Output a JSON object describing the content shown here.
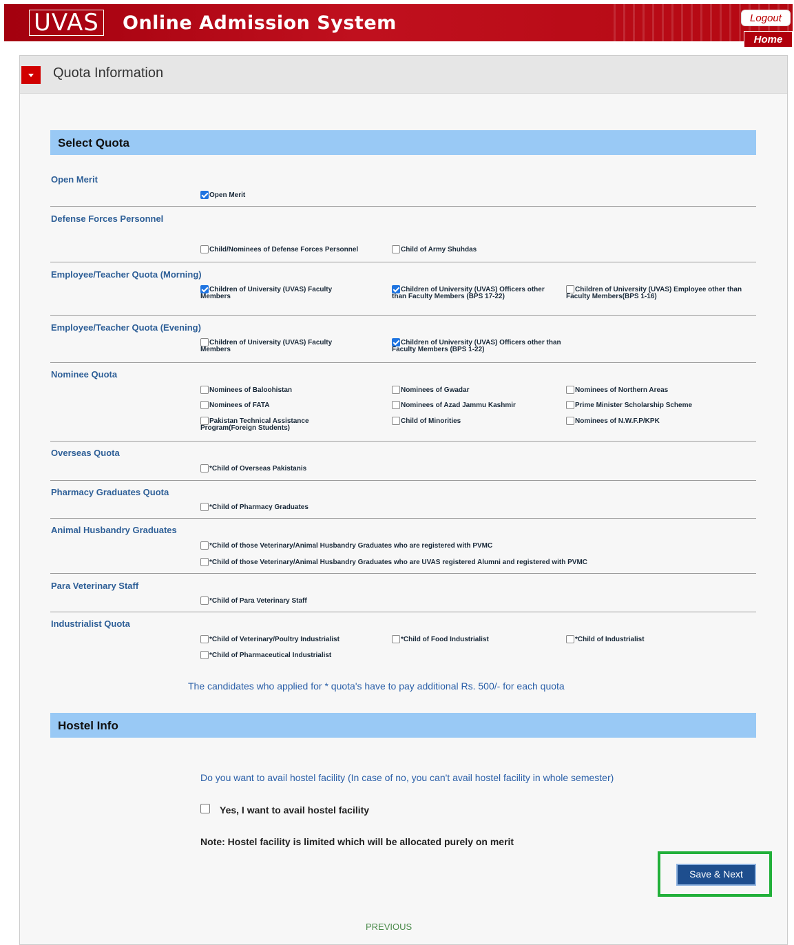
{
  "header": {
    "logo_text": "UVAS",
    "title": "Online Admission System",
    "logout_label": "Logout",
    "home_label": "Home",
    "brand_color": "#b0000c"
  },
  "panel": {
    "title": "Quota Information"
  },
  "select_quota": {
    "heading": "Select Quota",
    "groups": {
      "open_merit": {
        "label": "Open Merit",
        "options": [
          {
            "text": "Open Merit",
            "checked": true
          }
        ]
      },
      "defense": {
        "label": "Defense Forces Personnel",
        "options": [
          {
            "text": "Child/Nominees  of Defense Forces Personnel",
            "checked": false
          },
          {
            "text": "Child of Army Shuhdas",
            "checked": false
          }
        ]
      },
      "emp_morning": {
        "label": "Employee/Teacher Quota (Morning)",
        "options": [
          {
            "text": "Children of University (UVAS) Faculty Members",
            "checked": true
          },
          {
            "text": "Children of University (UVAS) Officers other than Faculty Members (BPS 17-22)",
            "checked": true
          },
          {
            "text": "Children of University (UVAS) Employee other than Faculty Members(BPS 1-16)",
            "checked": false
          }
        ]
      },
      "emp_evening": {
        "label": "Employee/Teacher Quota (Evening)",
        "options": [
          {
            "text": "Children of University (UVAS) Faculty Members",
            "checked": false
          },
          {
            "text": "Children of University (UVAS) Officers other than Faculty Members (BPS 1-22)",
            "checked": true
          }
        ]
      },
      "nominee": {
        "label": "Nominee Quota",
        "options": [
          {
            "text": "Nominees of Baloohistan",
            "checked": false
          },
          {
            "text": "Nominees of Gwadar",
            "checked": false
          },
          {
            "text": "Nominees of Northern Areas",
            "checked": false
          },
          {
            "text": "Nominees of FATA",
            "checked": false
          },
          {
            "text": "Nominees of Azad Jammu Kashmir",
            "checked": false
          },
          {
            "text": "Prime Minister Scholarship Scheme",
            "checked": false
          },
          {
            "text": "Pakistan Technical Assistance Program(Foreign Students)",
            "checked": false
          },
          {
            "text": "Child of Minorities",
            "checked": false
          },
          {
            "text": "Nominees of N.W.F.P/KPK",
            "checked": false
          }
        ]
      },
      "overseas": {
        "label": "Overseas Quota",
        "options": [
          {
            "text": "*Child of Overseas Pakistanis",
            "checked": false
          }
        ]
      },
      "pharmacy": {
        "label": "Pharmacy Graduates Quota",
        "options": [
          {
            "text": "*Child of Pharmacy Graduates",
            "checked": false
          }
        ]
      },
      "animal": {
        "label": "Animal Husbandry Graduates",
        "options": [
          {
            "text": "*Child of those Veterinary/Animal Husbandry Graduates who are registered with PVMC",
            "checked": false
          },
          {
            "text": "*Child of those Veterinary/Animal Husbandry Graduates who are UVAS registered Alumni and registered with PVMC",
            "checked": false
          }
        ]
      },
      "para": {
        "label": "Para Veterinary Staff",
        "options": [
          {
            "text": "*Child of Para Veterinary Staff",
            "checked": false
          }
        ]
      },
      "industrialist": {
        "label": "Industrialist Quota",
        "options": [
          {
            "text": "*Child of Veterinary/Poultry Industrialist",
            "checked": false
          },
          {
            "text": "*Child of Food Industrialist",
            "checked": false
          },
          {
            "text": "*Child of Industrialist",
            "checked": false
          },
          {
            "text": "*Child of Pharmaceutical Industrialist",
            "checked": false
          }
        ]
      }
    },
    "fee_note": "The candidates who applied for * quota's have to pay additional Rs. 500/- for each quota"
  },
  "hostel": {
    "heading": "Hostel Info",
    "question": "Do you want to avail hostel facility (In case of no, you can't avail hostel facility in whole semester)",
    "option_label": "Yes, I want to avail hostel facility",
    "option_checked": false,
    "note": "Note: Hostel facility is limited which will be allocated purely on merit"
  },
  "actions": {
    "save_next_label": "Save & Next",
    "previous_label": "PREVIOUS",
    "highlight_color": "#22b03a"
  }
}
